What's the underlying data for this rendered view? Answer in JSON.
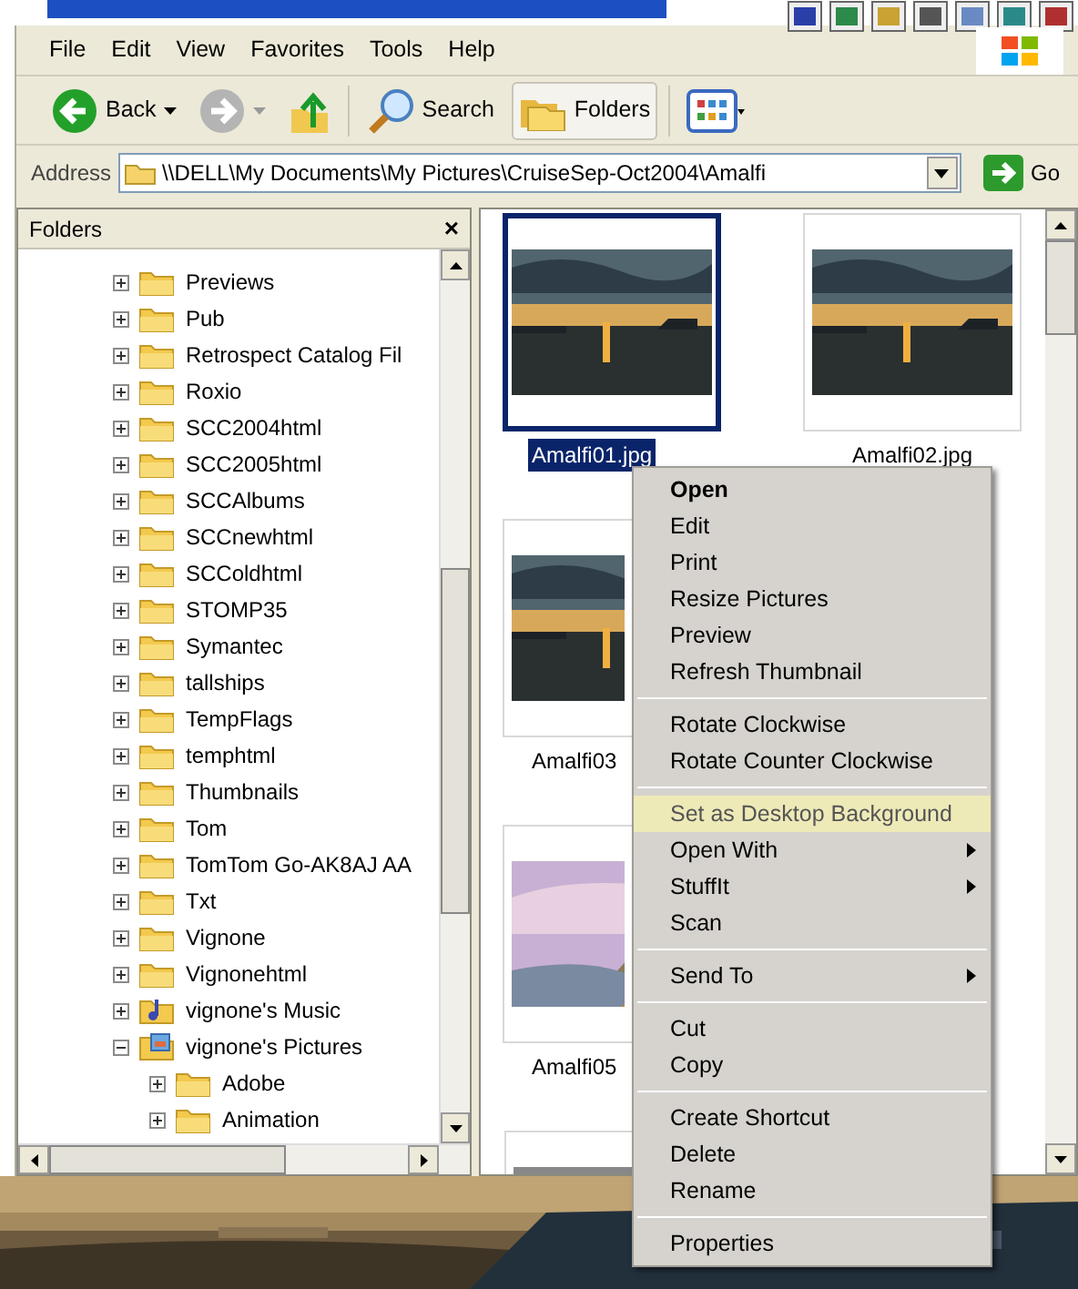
{
  "menu_bar": [
    "File",
    "Edit",
    "View",
    "Favorites",
    "Tools",
    "Help"
  ],
  "toolbar": [
    {
      "kind": "back",
      "label": "Back",
      "disabled": false
    },
    {
      "kind": "forward",
      "disabled": true
    },
    {
      "kind": "up"
    },
    {
      "kind": "search",
      "label": "Search",
      "selected": false
    },
    {
      "kind": "folders",
      "label": "Folders",
      "selected": true
    },
    {
      "kind": "views"
    }
  ],
  "address_bar": {
    "label": "Address",
    "value": "\\\\DELL\\My Documents\\My Pictures\\CruiseSep-Oct2004\\Amalfi",
    "go": "Go"
  },
  "folders_pane": {
    "title": "Folders",
    "close": "×",
    "tree": [
      {
        "label": "Previews",
        "kind": "folder",
        "expanded": false
      },
      {
        "label": "Pub",
        "kind": "folder",
        "expanded": false
      },
      {
        "label": "Retrospect Catalog Fil",
        "kind": "folder",
        "expanded": false
      },
      {
        "label": "Roxio",
        "kind": "folder",
        "expanded": false
      },
      {
        "label": "SCC2004html",
        "kind": "folder",
        "expanded": false
      },
      {
        "label": "SCC2005html",
        "kind": "folder",
        "expanded": false
      },
      {
        "label": "SCCAlbums",
        "kind": "folder",
        "expanded": false
      },
      {
        "label": "SCCnewhtml",
        "kind": "folder",
        "expanded": false
      },
      {
        "label": "SCColdhtml",
        "kind": "folder",
        "expanded": false
      },
      {
        "label": "STOMP35",
        "kind": "folder",
        "expanded": false
      },
      {
        "label": "Symantec",
        "kind": "folder",
        "expanded": false
      },
      {
        "label": "tallships",
        "kind": "folder",
        "expanded": false
      },
      {
        "label": "TempFlags",
        "kind": "folder",
        "expanded": false
      },
      {
        "label": "temphtml",
        "kind": "folder",
        "expanded": false
      },
      {
        "label": "Thumbnails",
        "kind": "folder",
        "expanded": false
      },
      {
        "label": "Tom",
        "kind": "folder",
        "expanded": false
      },
      {
        "label": "TomTom Go-AK8AJ AA",
        "kind": "folder",
        "expanded": false
      },
      {
        "label": "Txt",
        "kind": "folder",
        "expanded": false
      },
      {
        "label": "Vignone",
        "kind": "folder",
        "expanded": false
      },
      {
        "label": "Vignonehtml",
        "kind": "folder",
        "expanded": false
      },
      {
        "label": "vignone's Music",
        "kind": "music",
        "expanded": false
      },
      {
        "label": "vignone's Pictures",
        "kind": "pictures",
        "expanded": true,
        "children": [
          {
            "label": "Adobe",
            "kind": "folder",
            "expanded": false
          },
          {
            "label": "Animation",
            "kind": "folder",
            "expanded": false
          }
        ]
      }
    ]
  },
  "thumbnails": [
    {
      "label": "Amalfi01.jpg",
      "selected": true,
      "kind": "sunset"
    },
    {
      "label": "Amalfi02.jpg",
      "selected": false,
      "kind": "sunset"
    },
    {
      "label": "Amalfi03",
      "selected": false,
      "kind": "sunset"
    },
    {
      "label": "Amalfi05",
      "selected": false,
      "kind": "mountain"
    },
    {
      "selected": false,
      "kind": "gray"
    }
  ],
  "context_menu": [
    [
      {
        "label": "Open",
        "default": true,
        "selected": false,
        "submenu": false
      },
      {
        "label": "Edit",
        "default": false,
        "selected": false,
        "submenu": false
      },
      {
        "label": "Print",
        "default": false,
        "selected": false,
        "submenu": false
      },
      {
        "label": "Resize Pictures",
        "default": false,
        "selected": false,
        "submenu": false
      },
      {
        "label": "Preview",
        "default": false,
        "selected": false,
        "submenu": false
      },
      {
        "label": "Refresh Thumbnail",
        "default": false,
        "selected": false,
        "submenu": false
      }
    ],
    [
      {
        "label": "Rotate Clockwise",
        "default": false,
        "selected": false,
        "submenu": false
      },
      {
        "label": "Rotate Counter Clockwise",
        "default": false,
        "selected": false,
        "submenu": false
      }
    ],
    [
      {
        "label": "Set as Desktop Background",
        "default": false,
        "selected": true,
        "submenu": false
      },
      {
        "label": "Open With",
        "default": false,
        "selected": false,
        "submenu": true
      },
      {
        "label": "StuffIt",
        "default": false,
        "selected": false,
        "submenu": true
      },
      {
        "label": "Scan",
        "default": false,
        "selected": false,
        "submenu": false
      }
    ],
    [
      {
        "label": "Send To",
        "default": false,
        "selected": false,
        "submenu": true
      }
    ],
    [
      {
        "label": "Cut",
        "default": false,
        "selected": false,
        "submenu": false
      },
      {
        "label": "Copy",
        "default": false,
        "selected": false,
        "submenu": false
      }
    ],
    [
      {
        "label": "Create Shortcut",
        "default": false,
        "selected": false,
        "submenu": false
      },
      {
        "label": "Delete",
        "default": false,
        "selected": false,
        "submenu": false
      },
      {
        "label": "Rename",
        "default": false,
        "selected": false,
        "submenu": false
      }
    ],
    [
      {
        "label": "Properties",
        "default": false,
        "selected": false,
        "submenu": false
      }
    ]
  ]
}
